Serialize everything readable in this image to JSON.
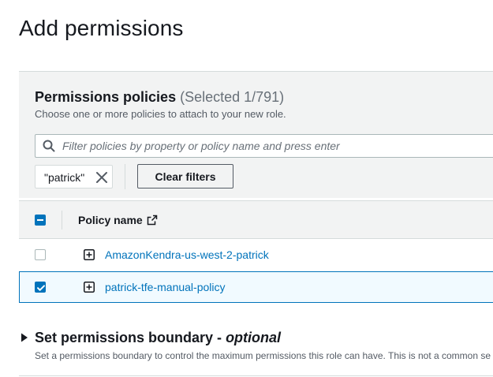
{
  "page": {
    "title": "Add permissions"
  },
  "policies_panel": {
    "title": "Permissions policies",
    "selected_count": "(Selected 1/791)",
    "description": "Choose one or more policies to attach to your new role.",
    "search": {
      "placeholder": "Filter policies by property or policy name and press enter",
      "value": ""
    },
    "filter_token": {
      "label": "\"patrick\""
    },
    "clear_filters_label": "Clear filters"
  },
  "table": {
    "header": {
      "select_all_state": "indeterminate",
      "column_policy_name": "Policy name"
    },
    "rows": [
      {
        "name": "AmazonKendra-us-west-2-patrick",
        "selected": false
      },
      {
        "name": "patrick-tfe-manual-policy",
        "selected": true
      }
    ]
  },
  "boundary_section": {
    "title": "Set permissions boundary - ",
    "title_optional": "optional",
    "description": "Set a permissions boundary to control the maximum permissions this role can have. This is not a common se"
  },
  "colors": {
    "accent": "#0073bb",
    "panel_bg": "#f2f3f3",
    "selected_row_bg": "#f1faff"
  }
}
